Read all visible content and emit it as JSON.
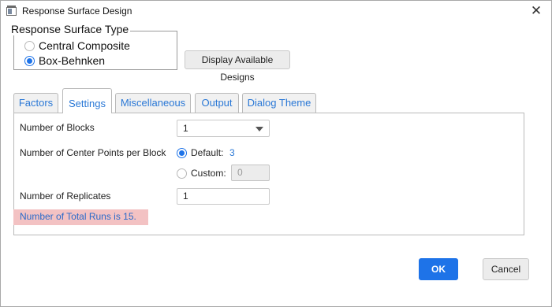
{
  "window": {
    "title": "Response Surface Design",
    "close_glyph": "✕"
  },
  "surface_type": {
    "legend": "Response Surface Type",
    "options": [
      {
        "label": "Central Composite",
        "selected": false
      },
      {
        "label": "Box-Behnken",
        "selected": true
      }
    ]
  },
  "display_designs_label": "Display Available Designs",
  "tabs": [
    {
      "label": "Factors",
      "active": false
    },
    {
      "label": "Settings",
      "active": true
    },
    {
      "label": "Miscellaneous",
      "active": false
    },
    {
      "label": "Output",
      "active": false
    },
    {
      "label": "Dialog Theme",
      "active": false
    }
  ],
  "settings": {
    "blocks_label": "Number of Blocks",
    "blocks_value": "1",
    "center_points_label": "Number of Center Points per Block",
    "default_label": "Default:",
    "default_value": "3",
    "default_selected": true,
    "custom_label": "Custom:",
    "custom_value": "0",
    "custom_selected": false,
    "replicates_label": "Number of Replicates",
    "replicates_value": "1",
    "total_runs_text": "Number of Total Runs is 15."
  },
  "buttons": {
    "ok": "OK",
    "cancel": "Cancel"
  },
  "colors": {
    "accent": "#1e73e8",
    "link": "#2a78d6",
    "warning_bg": "#f3c2c3"
  }
}
